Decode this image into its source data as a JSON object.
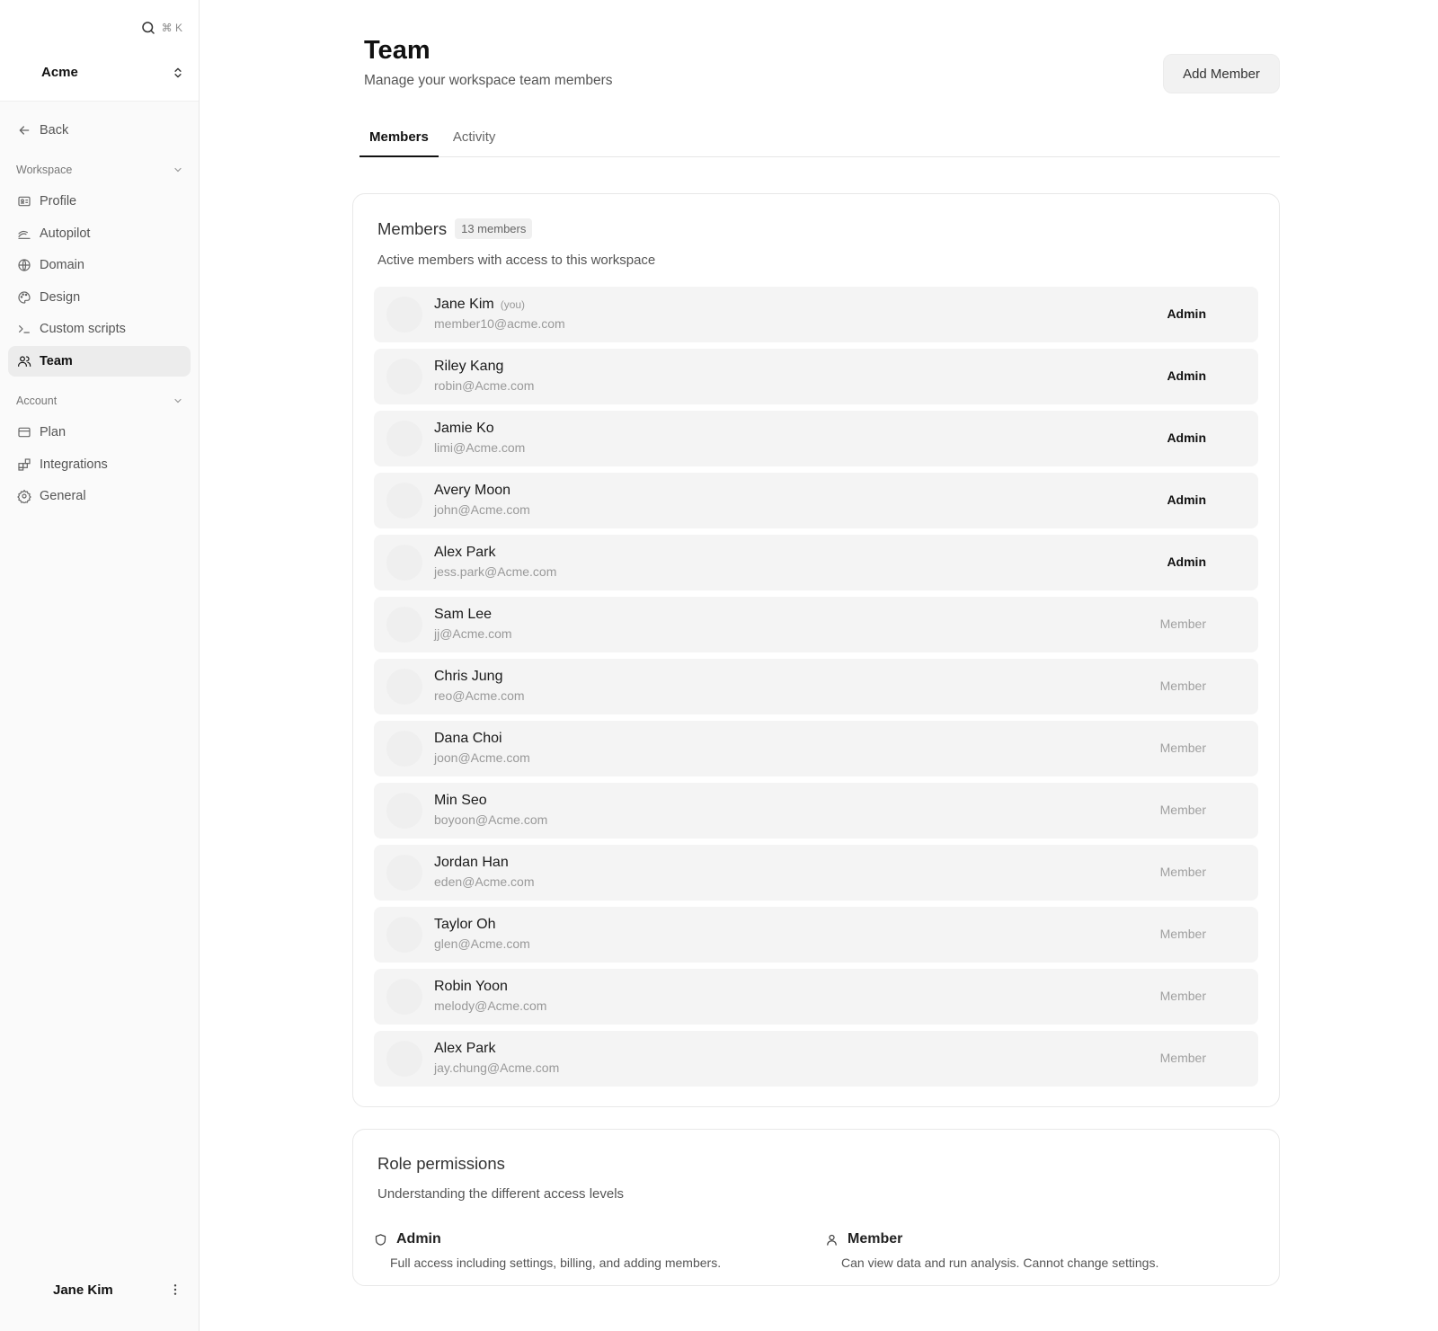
{
  "sidebar": {
    "search_shortcut": "⌘ K",
    "org_name": "Acme",
    "back_label": "Back",
    "workspace_heading": "Workspace",
    "workspace_items": [
      {
        "label": "Profile",
        "icon": "id-card-icon"
      },
      {
        "label": "Autopilot",
        "icon": "autopilot-icon"
      },
      {
        "label": "Domain",
        "icon": "globe-icon"
      },
      {
        "label": "Design",
        "icon": "palette-icon"
      },
      {
        "label": "Custom scripts",
        "icon": "terminal-icon"
      },
      {
        "label": "Team",
        "icon": "users-icon",
        "active": true
      }
    ],
    "account_heading": "Account",
    "account_items": [
      {
        "label": "Plan",
        "icon": "credit-card-icon"
      },
      {
        "label": "Integrations",
        "icon": "blocks-icon"
      },
      {
        "label": "General",
        "icon": "gear-icon"
      }
    ],
    "user_name": "Jane Kim"
  },
  "header": {
    "title": "Team",
    "subtitle": "Manage your workspace team members",
    "add_button": "Add Member"
  },
  "tabs": [
    {
      "label": "Members",
      "active": true
    },
    {
      "label": "Activity",
      "active": false
    }
  ],
  "members_card": {
    "title": "Members",
    "count_badge": "13 members",
    "description": "Active members with access to this workspace",
    "you_tag": "(you)",
    "members": [
      {
        "name": "Jane Kim",
        "email": "member10@acme.com",
        "role": "Admin",
        "you": true
      },
      {
        "name": "Riley Kang",
        "email": "robin@Acme.com",
        "role": "Admin"
      },
      {
        "name": "Jamie Ko",
        "email": "limi@Acme.com",
        "role": "Admin"
      },
      {
        "name": "Avery Moon",
        "email": "john@Acme.com",
        "role": "Admin"
      },
      {
        "name": "Alex Park",
        "email": "jess.park@Acme.com",
        "role": "Admin"
      },
      {
        "name": "Sam Lee",
        "email": "jj@Acme.com",
        "role": "Member"
      },
      {
        "name": "Chris Jung",
        "email": "reo@Acme.com",
        "role": "Member"
      },
      {
        "name": "Dana Choi",
        "email": "joon@Acme.com",
        "role": "Member"
      },
      {
        "name": "Min Seo",
        "email": "boyoon@Acme.com",
        "role": "Member"
      },
      {
        "name": "Jordan Han",
        "email": "eden@Acme.com",
        "role": "Member"
      },
      {
        "name": "Taylor Oh",
        "email": "glen@Acme.com",
        "role": "Member"
      },
      {
        "name": "Robin Yoon",
        "email": "melody@Acme.com",
        "role": "Member"
      },
      {
        "name": "Alex Park",
        "email": "jay.chung@Acme.com",
        "role": "Member"
      }
    ]
  },
  "permissions_card": {
    "title": "Role permissions",
    "description": "Understanding the different access levels",
    "admin": {
      "label": "Admin",
      "icon": "shield-icon",
      "text": "Full access including settings, billing, and adding members."
    },
    "member": {
      "label": "Member",
      "icon": "user-icon",
      "text": "Can view data and run analysis. Cannot change settings."
    }
  }
}
